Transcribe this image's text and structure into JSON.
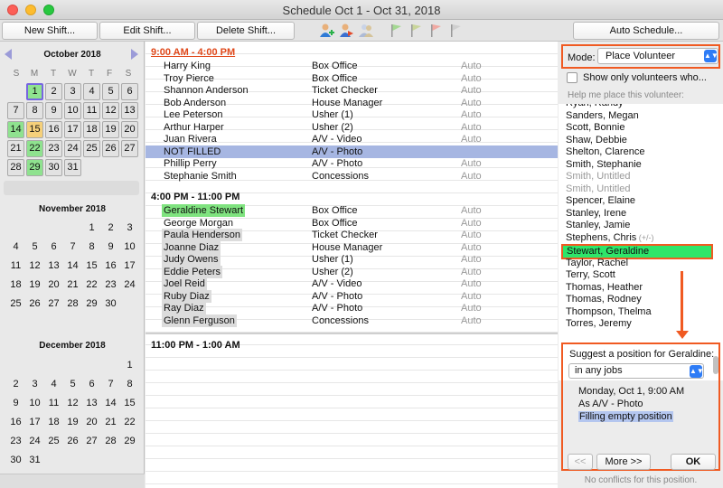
{
  "window": {
    "title": "Schedule Oct 1 - Oct 31, 2018"
  },
  "toolbar": {
    "new_shift": "New Shift...",
    "edit_shift": "Edit Shift...",
    "delete_shift": "Delete Shift...",
    "auto_schedule": "Auto Schedule...",
    "icons": [
      "add-volunteer-icon",
      "swap-volunteer-icon",
      "group-volunteer-icon",
      "flag-green-icon",
      "flag-orange-icon",
      "flag-red-icon",
      "flag-gray-icon"
    ]
  },
  "calendar": {
    "weekdays": [
      "S",
      "M",
      "T",
      "W",
      "T",
      "F",
      "S"
    ],
    "months": [
      {
        "title": "October 2018"
      },
      {
        "title": "November 2018"
      },
      {
        "title": "December 2018"
      }
    ]
  },
  "schedule": {
    "slots": [
      {
        "time": "9:00 AM - 4:00 PM",
        "rows": [
          {
            "name": "Harry King",
            "job": "Box Office",
            "status": "Auto"
          },
          {
            "name": "Troy Pierce",
            "job": "Box Office",
            "status": "Auto"
          },
          {
            "name": "Shannon Anderson",
            "job": "Ticket Checker",
            "status": "Auto"
          },
          {
            "name": "Bob Anderson",
            "job": "House Manager",
            "status": "Auto"
          },
          {
            "name": "Lee Peterson",
            "job": "Usher  (1)",
            "status": "Auto"
          },
          {
            "name": "Arthur Harper",
            "job": "Usher  (2)",
            "status": "Auto"
          },
          {
            "name": "Juan Rivera",
            "job": "A/V - Video",
            "status": "Auto"
          },
          {
            "name": "NOT FILLED",
            "job": "A/V - Photo",
            "status": ""
          },
          {
            "name": "Phillip Perry",
            "job": "A/V - Photo",
            "status": "Auto"
          },
          {
            "name": "Stephanie Smith",
            "job": "Concessions",
            "status": "Auto"
          }
        ]
      },
      {
        "time": "4:00 PM - 11:00 PM",
        "rows": [
          {
            "name": "Geraldine Stewart",
            "job": "Box Office",
            "status": "Auto"
          },
          {
            "name": "George Morgan",
            "job": "Box Office",
            "status": "Auto"
          },
          {
            "name": "Paula Henderson",
            "job": "Ticket Checker",
            "status": "Auto"
          },
          {
            "name": "Joanne Diaz",
            "job": "House Manager",
            "status": "Auto"
          },
          {
            "name": "Judy Owens",
            "job": "Usher  (1)",
            "status": "Auto"
          },
          {
            "name": "Eddie Peters",
            "job": "Usher  (2)",
            "status": "Auto"
          },
          {
            "name": "Joel Reid",
            "job": "A/V - Video",
            "status": "Auto"
          },
          {
            "name": "Ruby Diaz",
            "job": "A/V - Photo",
            "status": "Auto"
          },
          {
            "name": "Ray Diaz",
            "job": "A/V - Photo",
            "status": "Auto"
          },
          {
            "name": "Glenn Ferguson",
            "job": "Concessions",
            "status": "Auto"
          }
        ]
      },
      {
        "time": "11:00 PM - 1:00 AM",
        "rows": []
      }
    ]
  },
  "placement": {
    "mode_label": "Mode:",
    "mode_value": "Place Volunteer",
    "show_only_label": "Show only volunteers who...",
    "help_text": "Help me place this volunteer:",
    "volunteers": [
      "Ryan, Randy",
      "Sanders, Megan",
      "Scott, Bonnie",
      "Shaw, Debbie",
      "Shelton, Clarence",
      "Smith, Stephanie",
      "Smith, Untitled",
      "Smith, Untitled",
      "Spencer, Elaine",
      "Stanley, Irene",
      "Stanley, Jamie",
      "Stephens, Chris",
      "Stewart, Geraldine",
      "Taylor, Rachel",
      "Terry, Scott",
      "Thomas, Heather",
      "Thomas, Rodney",
      "Thompson, Thelma",
      "Torres, Jeremy"
    ],
    "stephens_suffix": "(+/-)",
    "suggest_title": "Suggest a position for Geraldine:",
    "jobs_filter": "in any jobs",
    "suggestion_date": "Monday, Oct 1, 9:00 AM",
    "suggestion_job": "As A/V - Photo",
    "suggestion_note": "Filling empty position",
    "prev_label": "<<",
    "more_label": "More >>",
    "ok_label": "OK",
    "conflicts_text": "No conflicts for this position."
  }
}
